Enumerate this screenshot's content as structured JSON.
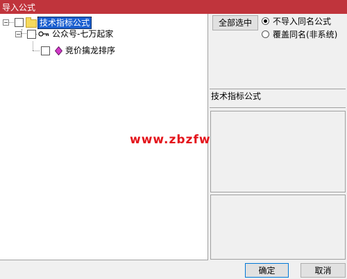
{
  "window": {
    "title": "导入公式"
  },
  "tree": {
    "root": {
      "label": "技术指标公式"
    },
    "group": {
      "label": "公众号-七万起家"
    },
    "formula": {
      "label": "竞价擒龙排序"
    }
  },
  "watermark": "www.zbzfwu.com",
  "options": {
    "select_all_label": "全部选中",
    "radio_skip_label": "不导入同名公式",
    "radio_overwrite_label": "覆盖同名(非系统)",
    "selected": "skip"
  },
  "info": {
    "category_label": "技术指标公式"
  },
  "footer": {
    "ok_label": "确定",
    "cancel_label": "取消"
  }
}
